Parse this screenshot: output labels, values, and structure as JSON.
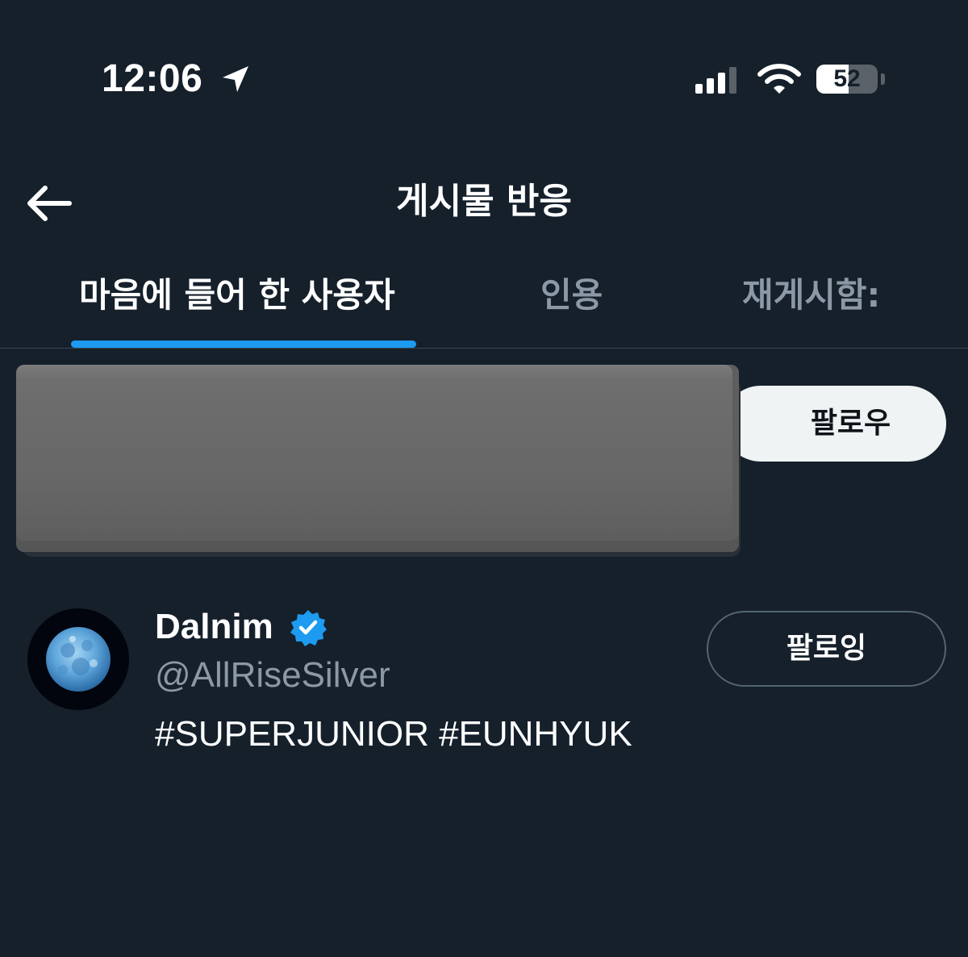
{
  "status_bar": {
    "time": "12:06",
    "battery_level": "52",
    "battery_fraction": 0.52,
    "icons": [
      "location-arrow-icon",
      "signal-icon",
      "wifi-icon",
      "battery-icon"
    ]
  },
  "header": {
    "back_icon": "arrow-left-icon",
    "title": "게시물 반응"
  },
  "tabs": [
    {
      "label": "마음에 들어 한 사용자",
      "active": true
    },
    {
      "label": "인용",
      "active": false
    },
    {
      "label": "재게시함:",
      "active": false
    }
  ],
  "users": [
    {
      "redacted": true,
      "follow_label": "팔로우"
    },
    {
      "display_name": "Dalnim",
      "verified": true,
      "handle": "@AllRiseSilver",
      "bio": "#SUPERJUNIOR #EUNHYUK",
      "follow_label": "팔로잉"
    }
  ],
  "colors": {
    "background": "#15202b",
    "accent": "#1d9bf0",
    "secondary_text": "#8b98a5",
    "divider": "#38444d"
  }
}
